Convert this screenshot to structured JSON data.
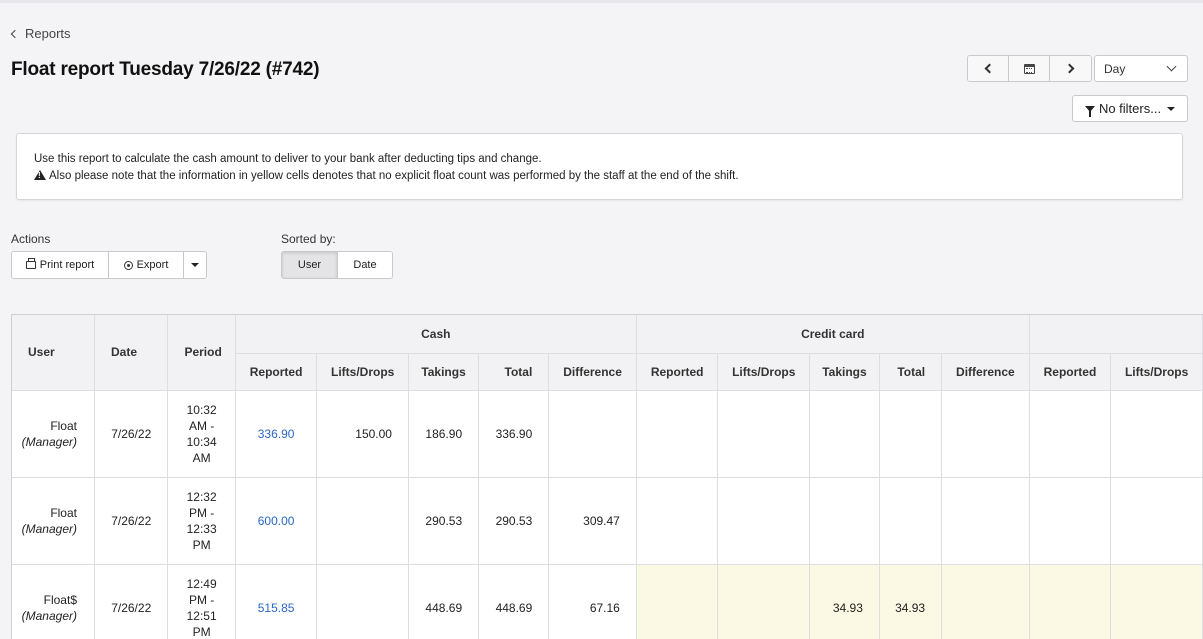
{
  "breadcrumb": {
    "back_label": "Reports"
  },
  "page_title": "Float report Tuesday 7/26/22 (#742)",
  "toolbar": {
    "period_value": "Day",
    "filters_label": "No filters..."
  },
  "info": {
    "line1": "Use this report to calculate the cash amount to deliver to your bank after deducting tips and change.",
    "line2": "Also please note that the information in yellow cells denotes that no explicit float count was performed by the staff at the end of the shift."
  },
  "actions": {
    "label": "Actions",
    "print_label": "Print report",
    "export_label": "Export"
  },
  "sort": {
    "label": "Sorted by:",
    "options": [
      "User",
      "Date"
    ],
    "selected": "User"
  },
  "table": {
    "headers": {
      "user": "User",
      "date": "Date",
      "period": "Period"
    },
    "groups": [
      "Cash",
      "Credit card"
    ],
    "subheaders": [
      "Reported",
      "Lifts/Drops",
      "Takings",
      "Total",
      "Difference"
    ],
    "highlight_color": "#fbf8e3",
    "rows": [
      {
        "user": "Float",
        "role": "(Manager)",
        "date": "7/26/22",
        "period": [
          "10:32",
          "AM -",
          "10:34",
          "AM"
        ],
        "cash": {
          "reported": "336.90",
          "lifts": "150.00",
          "takings": "186.90",
          "total": "336.90",
          "difference": ""
        },
        "card": {
          "reported": "",
          "lifts": "",
          "takings": "",
          "total": "",
          "difference": ""
        },
        "next": {
          "reported": "",
          "lifts": ""
        }
      },
      {
        "user": "Float",
        "role": "(Manager)",
        "date": "7/26/22",
        "period": [
          "12:32",
          "PM -",
          "12:33",
          "PM"
        ],
        "cash": {
          "reported": "600.00",
          "lifts": "",
          "takings": "290.53",
          "total": "290.53",
          "difference": "309.47"
        },
        "card": {
          "reported": "",
          "lifts": "",
          "takings": "",
          "total": "",
          "difference": ""
        },
        "next": {
          "reported": "",
          "lifts": ""
        }
      },
      {
        "user": "Float$",
        "role": "(Manager)",
        "date": "7/26/22",
        "period": [
          "12:49",
          "PM -",
          "12:51",
          "PM"
        ],
        "cash": {
          "reported": "515.85",
          "lifts": "",
          "takings": "448.69",
          "total": "448.69",
          "difference": "67.16"
        },
        "card": {
          "reported": "",
          "lifts": "",
          "takings": "34.93",
          "total": "34.93",
          "difference": ""
        },
        "next": {
          "reported": "",
          "lifts": ""
        }
      }
    ]
  }
}
